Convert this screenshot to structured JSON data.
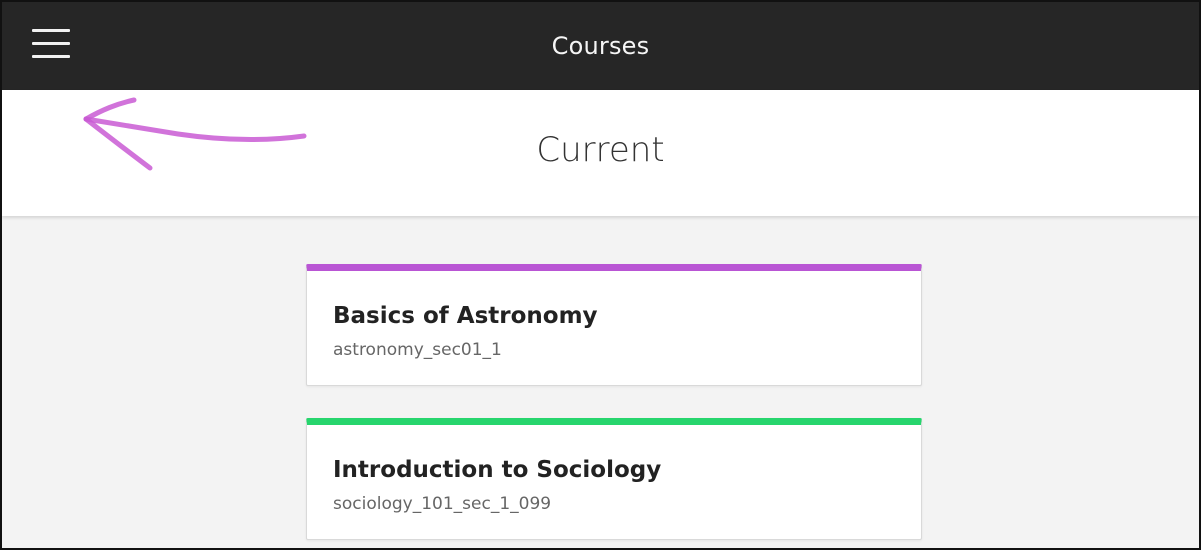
{
  "header": {
    "title": "Courses",
    "menu_icon": "hamburger-menu-icon"
  },
  "subheader": {
    "title": "Current"
  },
  "annotation": {
    "icon": "left-arrow-annotation-icon",
    "color": "#c95ad4"
  },
  "courses": [
    {
      "name": "Basics of Astronomy",
      "id": "astronomy_sec01_1",
      "accent": "#b955d4"
    },
    {
      "name": "Introduction to Sociology",
      "id": "sociology_101_sec_1_099",
      "accent": "#27d56d"
    }
  ]
}
